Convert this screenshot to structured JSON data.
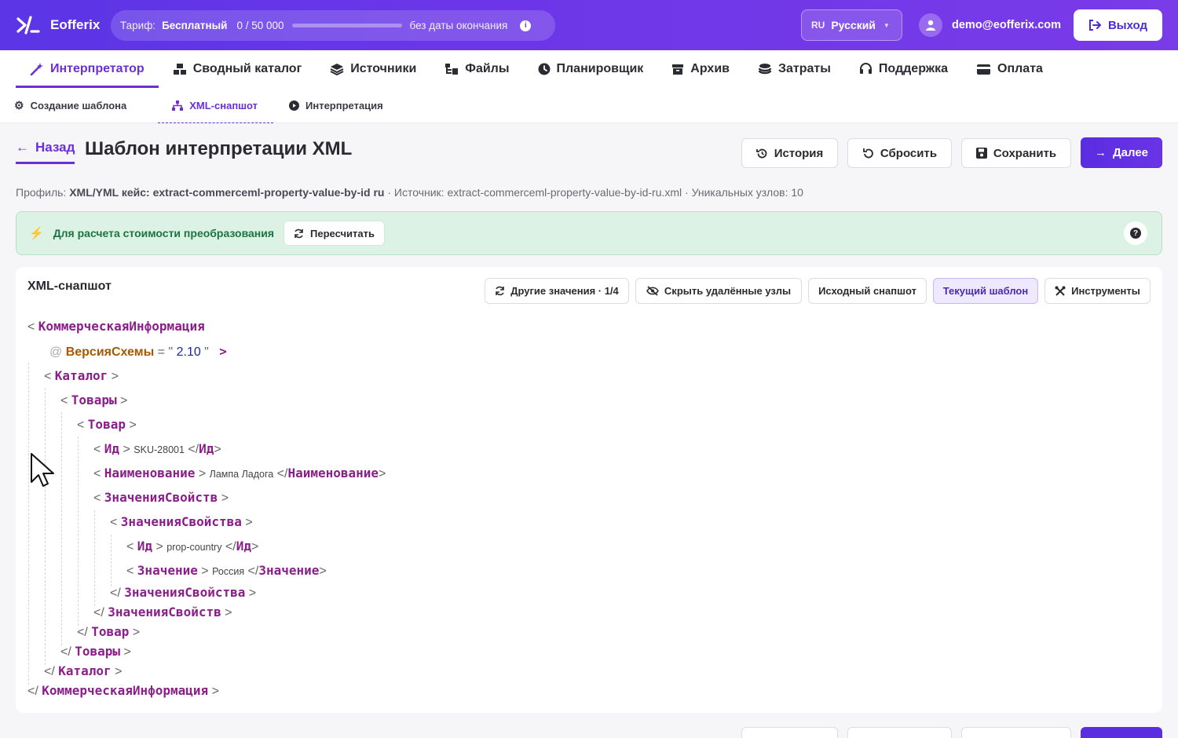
{
  "app": {
    "name": "Eofferix"
  },
  "tariff": {
    "label": "Тариф:",
    "plan": "Бесплатный",
    "usage": "0 / 50 000",
    "progress": 0.0,
    "period": "без даты окончания"
  },
  "language": {
    "code": "RU",
    "name": "Русский"
  },
  "user": {
    "email": "demo@eofferix.com"
  },
  "logout": {
    "label": "Выход"
  },
  "main_nav": [
    {
      "label": "Интерпретатор",
      "icon": "wand-icon",
      "active": true
    },
    {
      "label": "Сводный каталог",
      "icon": "boxes-icon"
    },
    {
      "label": "Источники",
      "icon": "layers-icon"
    },
    {
      "label": "Файлы",
      "icon": "folder-tree-icon"
    },
    {
      "label": "Планировщик",
      "icon": "clock-icon"
    },
    {
      "label": "Архив",
      "icon": "archive-icon"
    },
    {
      "label": "Затраты",
      "icon": "coins-icon"
    },
    {
      "label": "Поддержка",
      "icon": "headset-icon"
    },
    {
      "label": "Оплата",
      "icon": "card-icon"
    }
  ],
  "sub_nav": [
    {
      "label": "Создание шаблона",
      "icon": "gear-icon"
    },
    {
      "label": "XML-снапшот",
      "icon": "sitemap-icon",
      "active": true
    },
    {
      "label": "Интерпретация",
      "icon": "play-icon"
    }
  ],
  "header": {
    "back": "Назад",
    "title": "Шаблон интерпретации XML",
    "history": "История",
    "reset": "Сбросить",
    "save": "Сохранить",
    "next": "Далее"
  },
  "meta": {
    "profile_label": "Профиль:",
    "profile_value": "XML/YML кейс: extract-commerceml-property-value-by-id ru",
    "source": "· Источник: extract-commerceml-property-value-by-id-ru.xml · Уникальных узлов: 10"
  },
  "alert": {
    "text": "Для расчета стоимости преобразования",
    "recalc": "Пересчитать"
  },
  "snapshot": {
    "title": "XML-снапшот",
    "toolbar": {
      "other_values": "Другие значения · 1/4",
      "hide_deleted": "Скрыть удалённые узлы",
      "original": "Исходный снапшот",
      "current": "Текущий шаблон",
      "tools": "Инструменты"
    },
    "xml": {
      "root": "КоммерческаяИнформация",
      "attr_name": "ВерсияСхемы",
      "attr_value": "2.10",
      "catalog": "Каталог",
      "goods": "Товары",
      "good": "Товар",
      "id": "Ид",
      "id_value": "SKU-28001",
      "name": "Наименование",
      "name_value": "Лампа Ладога",
      "props": "ЗначенияСвойств",
      "prop": "ЗначенияСвойства",
      "prop_id_value": "prop-country",
      "value": "Значение",
      "value_value": "Россия"
    }
  }
}
